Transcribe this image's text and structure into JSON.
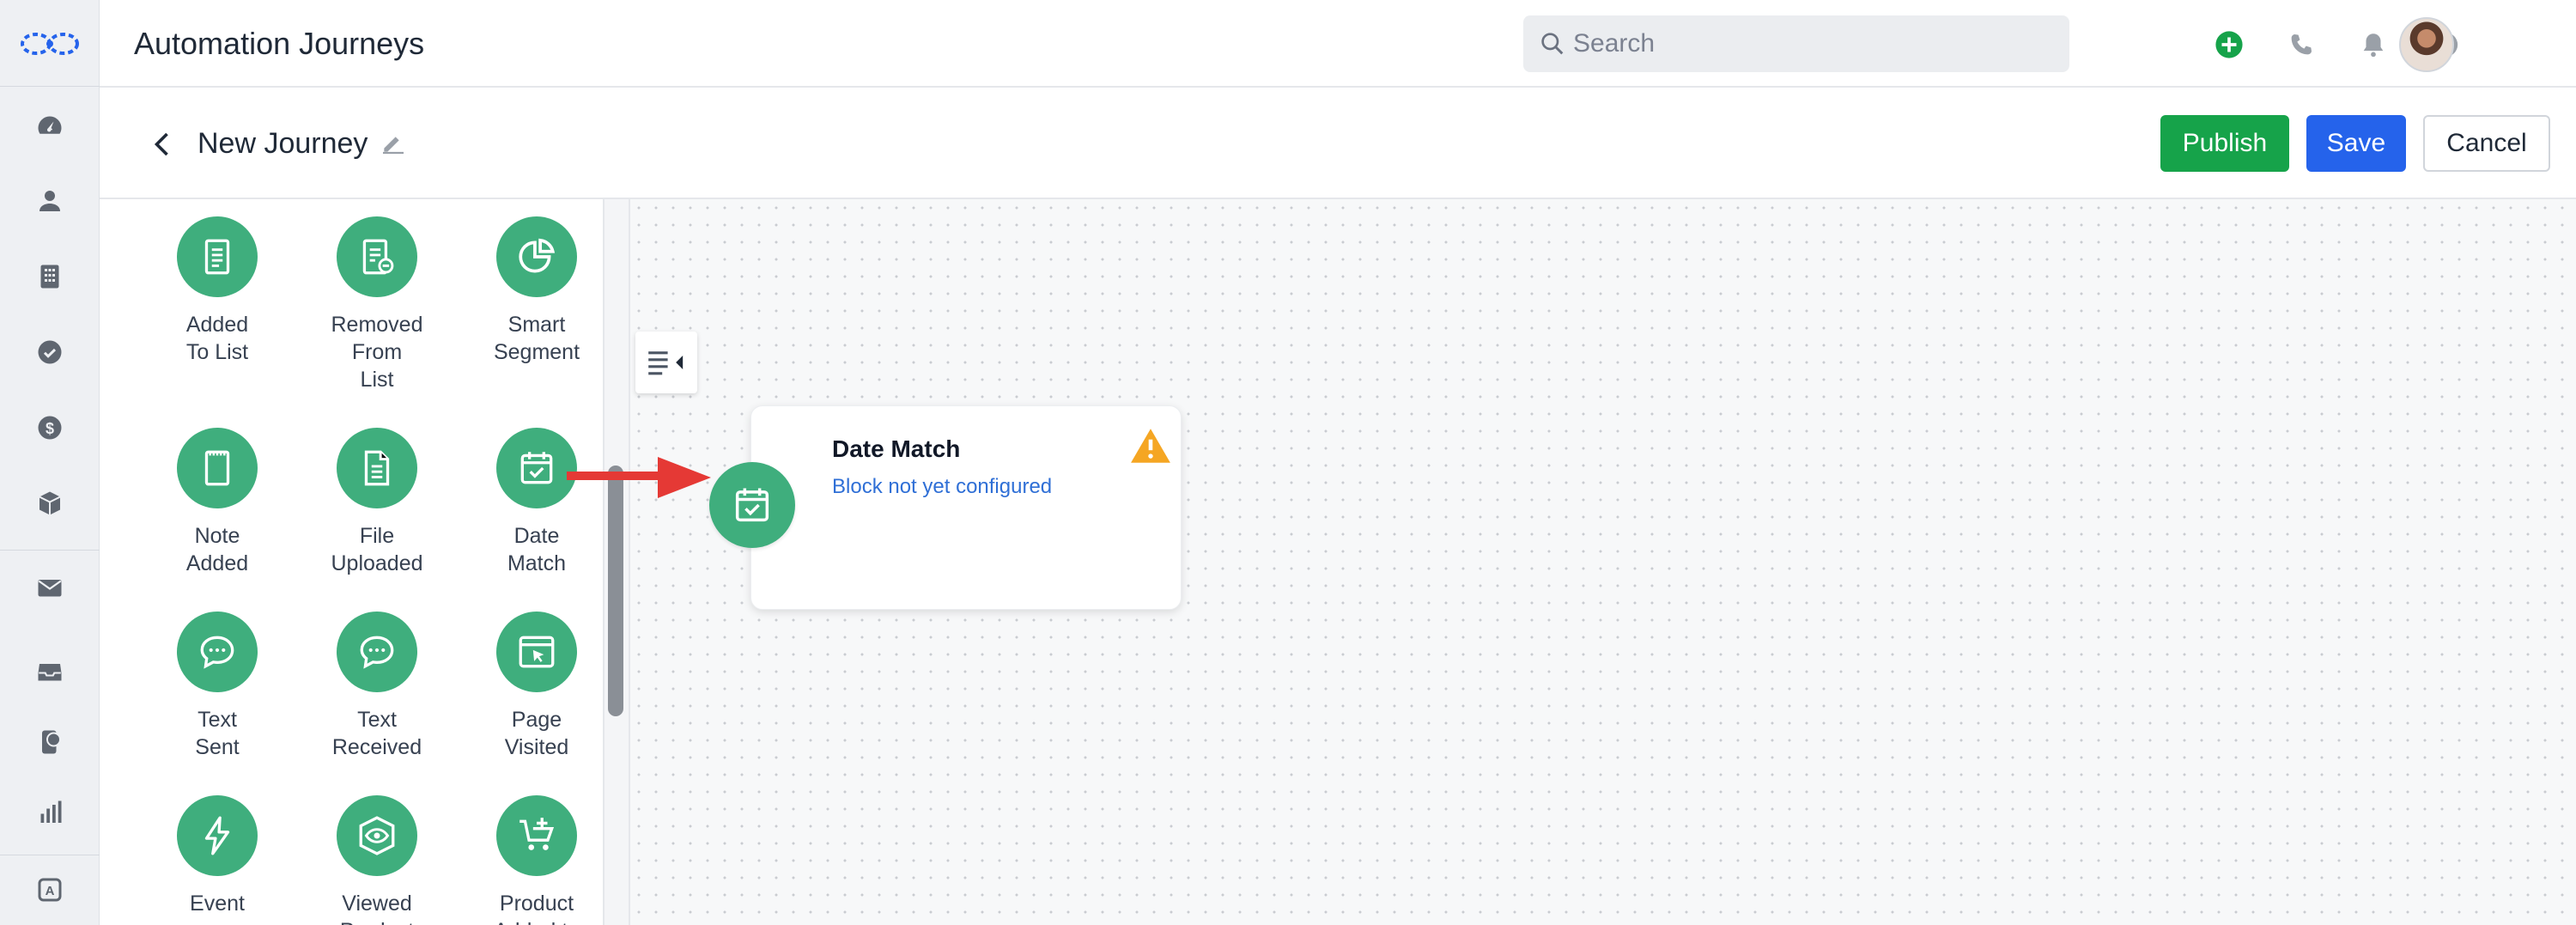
{
  "header": {
    "app_title": "Automation Journeys",
    "search_placeholder": "Search"
  },
  "subheader": {
    "journey_title": "New Journey",
    "publish_label": "Publish",
    "save_label": "Save",
    "cancel_label": "Cancel"
  },
  "palette": {
    "items": [
      {
        "label": "Added\nTo List",
        "icon": "list-add-icon"
      },
      {
        "label": "Removed\nFrom\nList",
        "icon": "list-remove-icon"
      },
      {
        "label": "Smart\nSegment",
        "icon": "pie-segment-icon"
      },
      {
        "label": "Note\nAdded",
        "icon": "note-icon"
      },
      {
        "label": "File\nUploaded",
        "icon": "file-icon"
      },
      {
        "label": "Date\nMatch",
        "icon": "calendar-check-icon"
      },
      {
        "label": "Text\nSent",
        "icon": "chat-sent-icon"
      },
      {
        "label": "Text\nReceived",
        "icon": "chat-received-icon"
      },
      {
        "label": "Page\nVisited",
        "icon": "browser-click-icon"
      },
      {
        "label": "Event",
        "icon": "lightning-icon"
      },
      {
        "label": "Viewed\nProduct",
        "icon": "box-eye-icon"
      },
      {
        "label": "Product\nAdded to",
        "icon": "cart-add-icon"
      }
    ]
  },
  "canvas": {
    "node": {
      "title": "Date Match",
      "status": "Block not yet configured"
    }
  },
  "colors": {
    "green_accent": "#3fae7d",
    "publish": "#16a34a",
    "save": "#2563eb",
    "link": "#2f6fd6",
    "warning": "#f5a623",
    "arrow": "#e53935"
  }
}
